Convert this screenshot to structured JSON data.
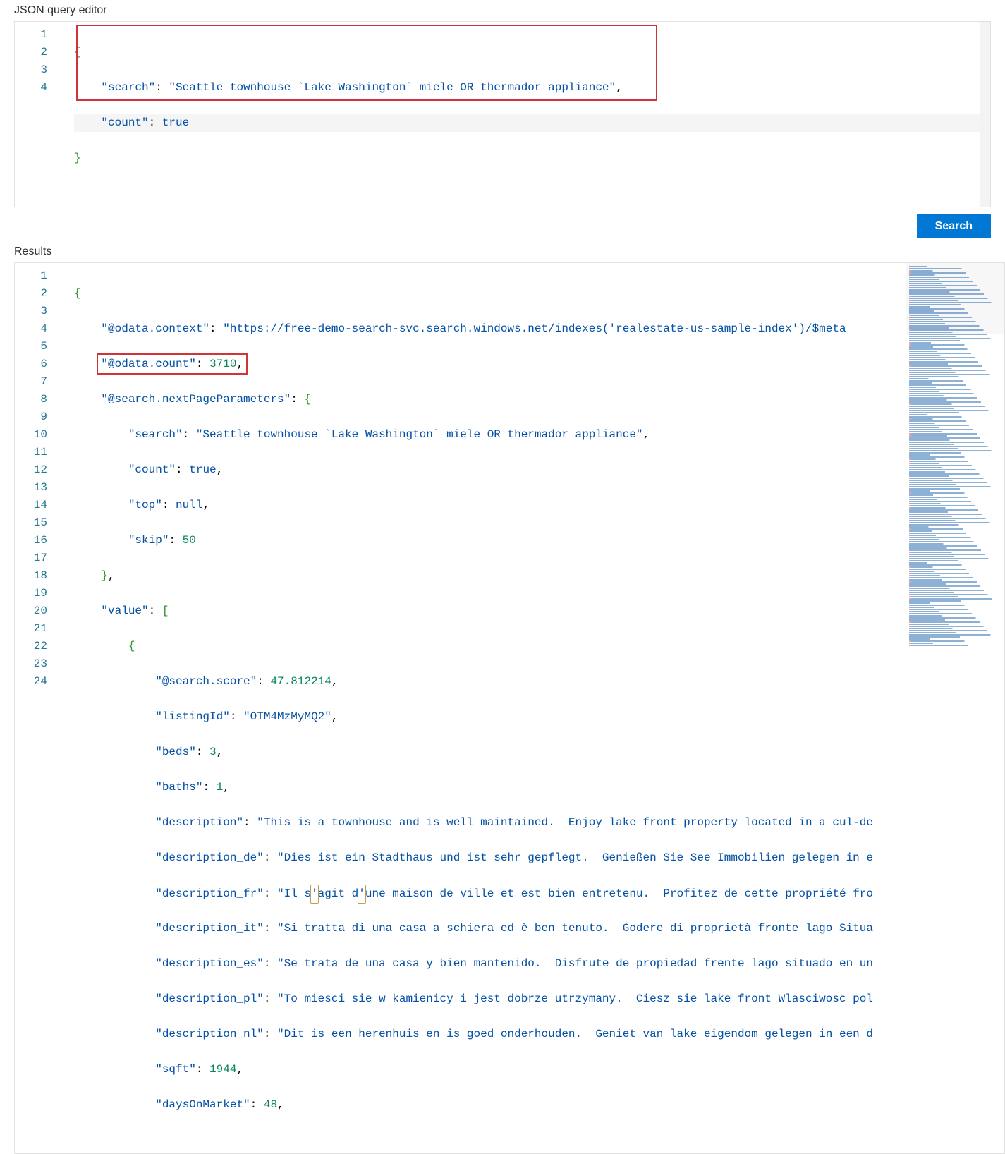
{
  "labels": {
    "query_editor": "JSON query editor",
    "results": "Results",
    "search_button": "Search"
  },
  "query": {
    "lines": [
      "1",
      "2",
      "3",
      "4"
    ],
    "search_key": "\"search\"",
    "search_val": "\"Seattle townhouse `Lake Washington` miele OR thermador appliance\"",
    "count_key": "\"count\"",
    "count_val": "true"
  },
  "results": {
    "lines": [
      "1",
      "2",
      "3",
      "4",
      "5",
      "6",
      "7",
      "8",
      "9",
      "10",
      "11",
      "12",
      "13",
      "14",
      "15",
      "16",
      "17",
      "18",
      "19",
      "20",
      "21",
      "22",
      "23",
      "24"
    ],
    "odata_context_key": "\"@odata.context\"",
    "odata_context_val": "\"https://free-demo-search-svc.search.windows.net/indexes('realestate-us-sample-index')/$meta",
    "odata_count_key": "\"@odata.count\"",
    "odata_count_val": "3710",
    "next_params_key": "\"@search.nextPageParameters\"",
    "np_search_key": "\"search\"",
    "np_search_val": "\"Seattle townhouse `Lake Washington` miele OR thermador appliance\"",
    "np_count_key": "\"count\"",
    "np_count_val": "true",
    "np_top_key": "\"top\"",
    "np_top_val": "null",
    "np_skip_key": "\"skip\"",
    "np_skip_val": "50",
    "value_key": "\"value\"",
    "score_key": "\"@search.score\"",
    "score_val": "47.812214",
    "listing_key": "\"listingId\"",
    "listing_val": "\"OTM4MzMyMQ2\"",
    "beds_key": "\"beds\"",
    "beds_val": "3",
    "baths_key": "\"baths\"",
    "baths_val": "1",
    "desc_key": "\"description\"",
    "desc_val": "\"This is a townhouse and is well maintained.  Enjoy lake front property located in a cul-de",
    "desc_de_key": "\"description_de\"",
    "desc_de_val": "\"Dies ist ein Stadthaus und ist sehr gepflegt.  Genießen Sie See Immobilien gelegen in e",
    "desc_fr_key": "\"description_fr\"",
    "desc_fr_pre": "\"Il s",
    "desc_fr_q1": "'",
    "desc_fr_mid": "agit d",
    "desc_fr_q2": "'",
    "desc_fr_post": "une maison de ville et est bien entretenu.  Profitez de cette propriété fro",
    "desc_it_key": "\"description_it\"",
    "desc_it_val": "\"Si tratta di una casa a schiera ed è ben tenuto.  Godere di proprietà fronte lago Situa",
    "desc_es_key": "\"description_es\"",
    "desc_es_val": "\"Se trata de una casa y bien mantenido.  Disfrute de propiedad frente lago situado en un",
    "desc_pl_key": "\"description_pl\"",
    "desc_pl_val": "\"To miesci sie w kamienicy i jest dobrze utrzymany.  Ciesz sie lake front Wlasciwosc pol",
    "desc_nl_key": "\"description_nl\"",
    "desc_nl_val": "\"Dit is een herenhuis en is goed onderhouden.  Geniet van lake eigendom gelegen in een d",
    "sqft_key": "\"sqft\"",
    "sqft_val": "1944",
    "days_key": "\"daysOnMarket\"",
    "days_val": "48"
  }
}
